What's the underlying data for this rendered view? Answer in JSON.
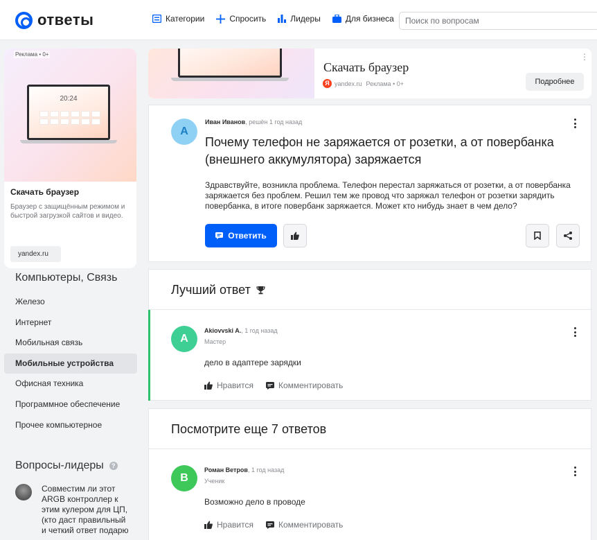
{
  "header": {
    "logo_text": "ответы",
    "nav": [
      {
        "label": "Категории",
        "icon": "list-icon"
      },
      {
        "label": "Спросить",
        "icon": "plus-icon"
      },
      {
        "label": "Лидеры",
        "icon": "bar-chart-icon"
      },
      {
        "label": "Для бизнеса",
        "icon": "briefcase-icon"
      }
    ],
    "search_placeholder": "Поиск по вопросам"
  },
  "left_ad": {
    "tag": "Реклама • 0+",
    "clock": "20:24",
    "title": "Скачать браузер",
    "description": "Браузер с защищённым режимом и быстрой загрузкой сайтов и видео.",
    "domain": "yandex.ru"
  },
  "categories": {
    "title": "Компьютеры, Связь",
    "items": [
      {
        "label": "Железо",
        "active": false
      },
      {
        "label": "Интернет",
        "active": false
      },
      {
        "label": "Мобильная связь",
        "active": false
      },
      {
        "label": "Мобильные устройства",
        "active": true
      },
      {
        "label": "Офисная техника",
        "active": false
      },
      {
        "label": "Программное обеспечение",
        "active": false
      },
      {
        "label": "Прочее компьютерное",
        "active": false
      }
    ]
  },
  "leaders": {
    "title": "Вопросы-лидеры",
    "help_icon": "?",
    "items": [
      {
        "text": "Совместим ли этот ARGB контроллер к этим кулером для ЦП, (кто даст правильный и четкий ответ подарю"
      }
    ]
  },
  "top_ad": {
    "title": "Скачать браузер",
    "source": "yandex.ru",
    "tag": "Реклама • 0+",
    "badge": "Я",
    "button": "Подробнее"
  },
  "question": {
    "avatar_letter": "A",
    "avatar_color": "#8fd0f5",
    "author": "Иван Иванов",
    "meta": ", решён 1 год назад",
    "title": "Почему телефон не заряжается от розетки, а от повербанка (внешнего аккумулятора) заряжается",
    "body": "Здравствуйте, возникла проблема. Телефон перестал заряжаться от розетки, а от повербанка заряжается без проблем. Решил тем же провод что заряжал телефон от розетки зарядить повербанка, в итоге повербанк заряжается. Может кто нибудь знает в чем дело?",
    "reply_button": "Ответить"
  },
  "best_answer": {
    "heading": "Лучший ответ",
    "avatar_letter": "A",
    "avatar_color": "#3ecf94",
    "author": "Akiovvski A.",
    "time": ", 1 год назад",
    "rank": "Мастер",
    "text": "дело в адаптере зарядки",
    "like_label": "Нравится",
    "comment_label": "Комментировать"
  },
  "more_answers": {
    "heading": "Посмотрите еще 7 ответов",
    "items": [
      {
        "avatar_letter": "B",
        "avatar_color": "#3fc85a",
        "author": "Роман Ветров",
        "time": ", 1 год назад",
        "rank": "Ученик",
        "text": "Возможно дело в проводе",
        "like_label": "Нравится",
        "comment_label": "Комментировать"
      }
    ]
  },
  "colors": {
    "accent": "#005ff9",
    "best_answer_bar": "#2cc26b"
  }
}
